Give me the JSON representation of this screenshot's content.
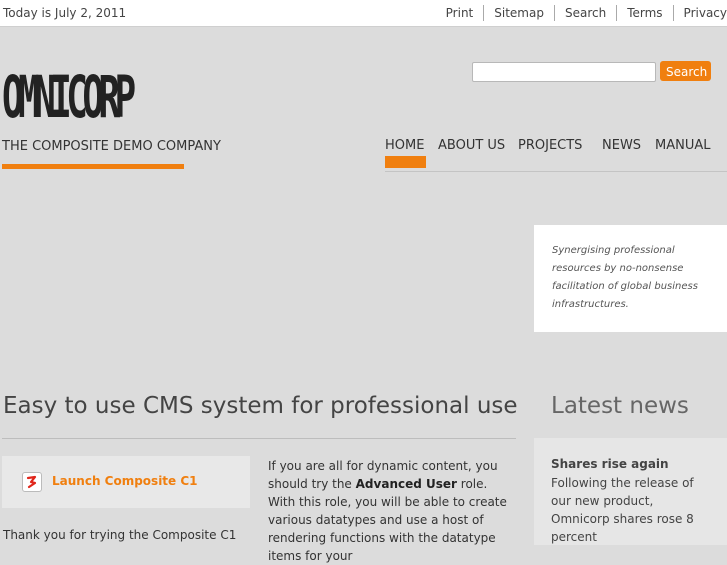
{
  "topbar": {
    "date": "Today is July 2, 2011",
    "links": [
      "Print",
      "Sitemap",
      "Search",
      "Terms",
      "Privacy"
    ]
  },
  "brand": {
    "logo": "OMNICORP",
    "tagline": "THE COMPOSITE DEMO COMPANY",
    "accent_color": "#f07f0f"
  },
  "search": {
    "value": "",
    "button_label": "Search"
  },
  "nav": {
    "items": [
      "HOME",
      "ABOUT US",
      "PROJECTS",
      "NEWS",
      "MANUAL"
    ],
    "active": "HOME"
  },
  "promo": {
    "text": "Synergising professional resources by no-nonsense facilitation of global business infrastructures."
  },
  "main": {
    "heading": "Easy to use CMS system for professional use",
    "launch_label": "Launch Composite C1",
    "launch_icon": "composite-c1-icon",
    "thanks": "Thank you for trying the Composite C1",
    "body_pre": "If you are all for dynamic content, you should try the ",
    "body_bold": "Advanced User",
    "body_post": " role. With this role, you will be able to create various datatypes and use a host of rendering functions with the datatype items for your"
  },
  "news": {
    "heading": "Latest news",
    "title": "Shares rise again",
    "text": "Following the release of our new product, Omnicorp shares rose 8 percent"
  }
}
